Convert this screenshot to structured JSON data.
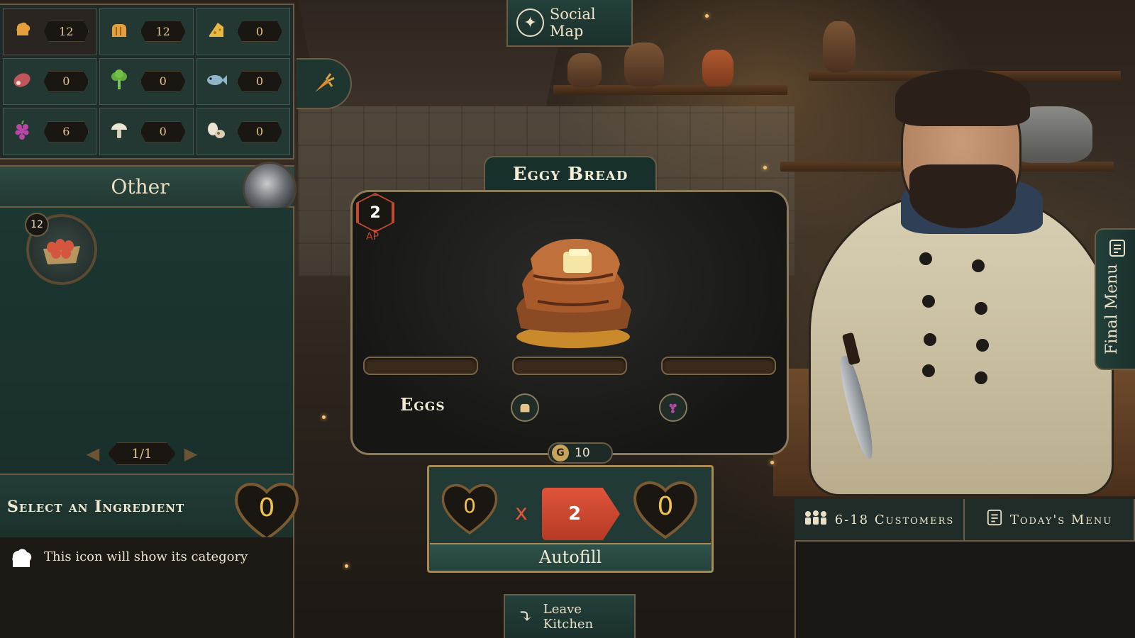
{
  "ingredients": [
    {
      "name": "dairy",
      "icon": "chef-hat-icon",
      "glyph": "🍞",
      "count": "12"
    },
    {
      "name": "bread",
      "icon": "bread-icon",
      "glyph": "🍞",
      "count": "12"
    },
    {
      "name": "cheese",
      "icon": "cheese-icon",
      "glyph": "🧀",
      "count": "0"
    },
    {
      "name": "meat",
      "icon": "meat-icon",
      "glyph": "🥩",
      "count": "0"
    },
    {
      "name": "vegetable",
      "icon": "broccoli-icon",
      "glyph": "🥦",
      "count": "0"
    },
    {
      "name": "fish",
      "icon": "fish-icon",
      "glyph": "🐟",
      "count": "0"
    },
    {
      "name": "fruit",
      "icon": "grapes-icon",
      "glyph": "🍇",
      "count": "6"
    },
    {
      "name": "fungi",
      "icon": "mushroom-icon",
      "glyph": "🍄",
      "count": "0"
    },
    {
      "name": "other",
      "icon": "egg-nut-icon",
      "glyph": "🥚",
      "count": "0"
    }
  ],
  "category": {
    "title": "Other",
    "item": {
      "name": "eggs",
      "count": "12"
    },
    "pager": "1/1"
  },
  "select": {
    "title": "Select an Ingredient",
    "value": "0",
    "hint": "This icon will show its category"
  },
  "social_map": {
    "label": "Social Map"
  },
  "recipe": {
    "title": "Eggy Bread",
    "ap_value": "2",
    "ap_label": "AP",
    "slots": [
      "Eggs",
      "",
      ""
    ],
    "gold": "10",
    "gold_symbol": "G"
  },
  "autofill": {
    "left_value": "0",
    "multiplier": "x",
    "quantity": "2",
    "right_value": "0",
    "label": "Autofill"
  },
  "leave": {
    "label": "Leave Kitchen"
  },
  "final_menu": {
    "label": "Final Menu"
  },
  "menu_tabs": {
    "customers": "6-18 Customers",
    "today": "Today's Menu"
  },
  "colors": {
    "panel_teal": "#1f3530",
    "border_gold": "#6a5d43",
    "accent_red": "#e0533a",
    "value_gold": "#f2c24f"
  }
}
